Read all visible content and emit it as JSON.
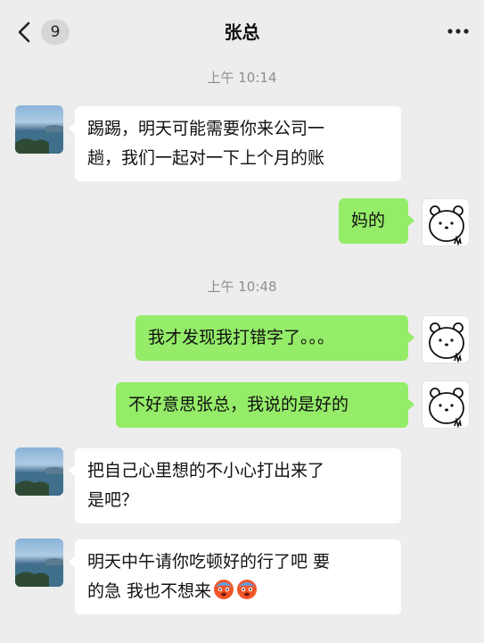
{
  "header": {
    "back_label": "<",
    "unread_count": "9",
    "title": "张总",
    "more_label": "more"
  },
  "timestamps": [
    "上午 10:14",
    "上午 10:48"
  ],
  "messages": [
    {
      "side": "left",
      "text_line1": "踢踢，明天可能需要你来公司一",
      "text_line2": "趟，我们一起对一下上个月的账"
    },
    {
      "side": "right",
      "text": "妈的"
    },
    {
      "side": "right",
      "text": "我才发现我打错字了。。。"
    },
    {
      "side": "right",
      "text": "不好意思张总，我说的是好的"
    },
    {
      "side": "left",
      "text_line1": "把自己心里想的不小心打出来了",
      "text_line2": "是吧？"
    },
    {
      "side": "left",
      "text_line1": "明天中午请你吃顿好的行了吧 要",
      "text_line2": "的急 我也不想来",
      "emoji": [
        "cold-sweat-emoji",
        "cold-sweat-emoji"
      ]
    }
  ],
  "colors": {
    "background": "#ededed",
    "incoming_bubble": "#ffffff",
    "outgoing_bubble": "#95ec69",
    "timestamp": "#8e8e8e"
  },
  "icons": {
    "back": "chevron-left-icon",
    "more": "more-dots-icon",
    "contact_avatar": "landscape-avatar",
    "self_avatar": "polar-bear-avatar"
  }
}
